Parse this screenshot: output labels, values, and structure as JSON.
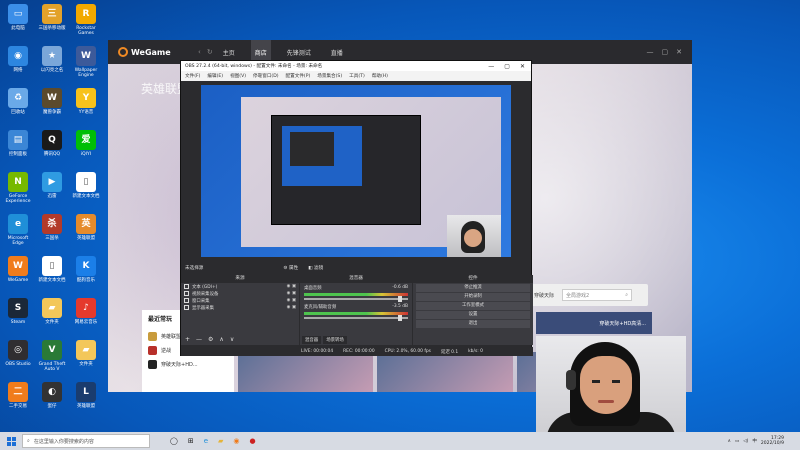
{
  "desktop": {
    "icons": [
      {
        "label": "此电脑",
        "color": "#3b8ee8",
        "glyph": "▭"
      },
      {
        "label": "三国杀移动版",
        "color": "#e3a22a",
        "glyph": "三"
      },
      {
        "label": "Rockstar Games",
        "color": "#f2a900",
        "glyph": "R"
      },
      {
        "label": "网络",
        "color": "#2d86e0",
        "glyph": "◉"
      },
      {
        "label": "以闪亮之名",
        "color": "#7ba7d9",
        "glyph": "★"
      },
      {
        "label": "Wallpaper Engine",
        "color": "#3c5a9a",
        "glyph": "W"
      },
      {
        "label": "回收站",
        "color": "#6aa9e8",
        "glyph": "♻"
      },
      {
        "label": "魔兽争霸",
        "color": "#5b4a2c",
        "glyph": "W"
      },
      {
        "label": "YY语音",
        "color": "#f7c21b",
        "glyph": "Y"
      },
      {
        "label": "控制面板",
        "color": "#3b86d6",
        "glyph": "▤"
      },
      {
        "label": "腾讯QQ",
        "color": "#1a1a1a",
        "glyph": "Q"
      },
      {
        "label": "iQIYI",
        "color": "#00be06",
        "glyph": "爱"
      },
      {
        "label": "GeForce Experience",
        "color": "#76b900",
        "glyph": "N"
      },
      {
        "label": "迅雷",
        "color": "#2f9be2",
        "glyph": "▶"
      },
      {
        "label": "新建文本文档",
        "color": "#ffffff",
        "glyph": "▯"
      },
      {
        "label": "Microsoft Edge",
        "color": "#1f8fd8",
        "glyph": "e"
      },
      {
        "label": "三国杀",
        "color": "#b33a2a",
        "glyph": "杀"
      },
      {
        "label": "英雄联盟",
        "color": "#e58b2c",
        "glyph": "英"
      },
      {
        "label": "WeGame",
        "color": "#f07c1c",
        "glyph": "W"
      },
      {
        "label": "新建文本文档",
        "color": "#ffffff",
        "glyph": "▯"
      },
      {
        "label": "酷狗音乐",
        "color": "#1b7fe8",
        "glyph": "K"
      },
      {
        "label": "Steam",
        "color": "#1b2838",
        "glyph": "S"
      },
      {
        "label": "文件夹",
        "color": "#f3c75a",
        "glyph": "▰"
      },
      {
        "label": "网易云音乐",
        "color": "#e5392c",
        "glyph": "♪"
      },
      {
        "label": "OBS Studio",
        "color": "#302e31",
        "glyph": "◎"
      },
      {
        "label": "Grand Theft Auto V",
        "color": "#2a7a36",
        "glyph": "V"
      },
      {
        "label": "文件夹",
        "color": "#f3c75a",
        "glyph": "▰"
      },
      {
        "label": "二手交易",
        "color": "#f07c1c",
        "glyph": "二"
      },
      {
        "label": "蛋仔",
        "color": "#333",
        "glyph": "◐"
      },
      {
        "label": "英雄联盟",
        "color": "#1a3c6e",
        "glyph": "L"
      }
    ]
  },
  "wegame": {
    "logo": "WeGame",
    "nav": [
      "主页",
      "商店",
      "先锋测试",
      "直播"
    ],
    "active_nav": 1,
    "game_title": "英雄联盟",
    "search_label": "穿破天际",
    "search_placeholder": "全局游戏2",
    "banner_text": "穿破天际+HD高清...",
    "recent_title": "最近常玩",
    "recent": [
      {
        "name": "英雄联盟",
        "color": "#c89b3c"
      },
      {
        "name": "逆战",
        "color": "#b8302a"
      },
      {
        "name": "穿破天际+HD...",
        "color": "#222"
      }
    ]
  },
  "obs": {
    "title": "OBS 27.2.4 (64-bit, windows) - 配置文件: 未命名 - 场景: 未命名",
    "menu": [
      "文件(F)",
      "编辑(E)",
      "视图(V)",
      "停靠窗口(D)",
      "配置文件(P)",
      "场景集合(S)",
      "工具(T)",
      "帮助(H)"
    ],
    "no_source_label": "未选择源",
    "properties": "属性",
    "filters": "滤镜",
    "docks": {
      "sources": "来源",
      "mixer": "混音器",
      "controls": "控件"
    },
    "sources": [
      "文本 (GDI+)",
      "视频采集设备",
      "窗口采集",
      "显示器采集"
    ],
    "mixer": [
      {
        "name": "桌面音频",
        "db": "-0.6 dB"
      },
      {
        "name": "麦克风/辅助音频",
        "db": "-3.5 dB"
      }
    ],
    "mixer_tabs": [
      "混音器",
      "场景转场"
    ],
    "controls": [
      "停止推流",
      "开始录制",
      "工作室模式",
      "设置",
      "退出"
    ],
    "status": [
      "LIVE: 00:00:04",
      "REC: 00:00:00",
      "CPU: 2.0%, 60.00 fps",
      "延迟 0.1",
      "kb/s: 0"
    ]
  },
  "taskbar": {
    "search_placeholder": "在这里输入你要搜索的内容",
    "time": "17:29",
    "date": "2022/10/9"
  }
}
